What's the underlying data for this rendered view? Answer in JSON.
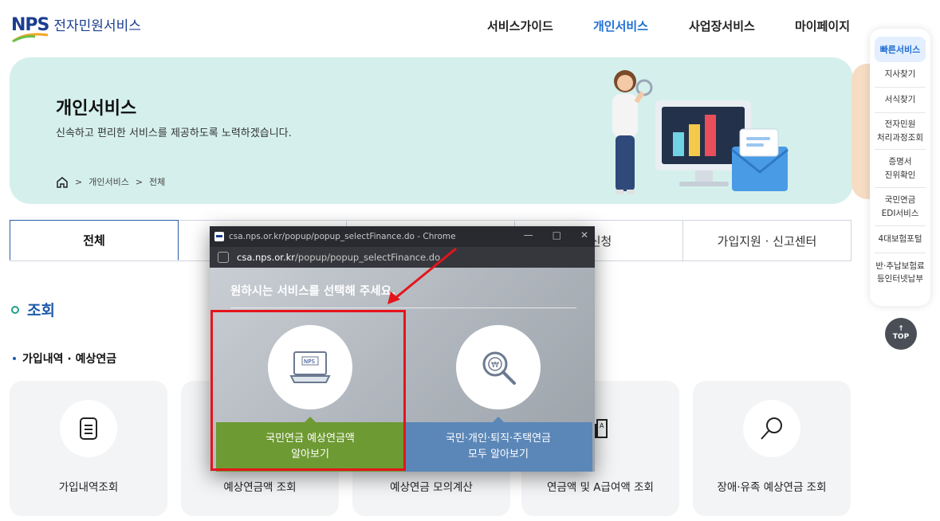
{
  "header": {
    "logo_mark": "NPS",
    "logo_text": "전자민원서비스",
    "nav": [
      {
        "label": "서비스가이드",
        "active": false
      },
      {
        "label": "개인서비스",
        "active": true
      },
      {
        "label": "사업장서비스",
        "active": false
      },
      {
        "label": "마이페이지",
        "active": false
      }
    ]
  },
  "hero": {
    "title": "개인서비스",
    "description": "신속하고 편리한 서비스를 제공하도록 노력하겠습니다.",
    "breadcrumb": [
      "개인서비스",
      "전체"
    ],
    "home_icon": "home-icon"
  },
  "tabs": [
    {
      "label": "전체",
      "active": true
    },
    {
      "label": "",
      "active": false
    },
    {
      "label": "",
      "active": false
    },
    {
      "label": "/신청",
      "active": false
    },
    {
      "label": "가입지원 · 신고센터",
      "active": false
    }
  ],
  "section": {
    "title": "조회",
    "subtitle": "가입내역 · 예상연금"
  },
  "cards": [
    {
      "label": "가입내역조회",
      "icon": "document-icon"
    },
    {
      "label": "예상연금액 조회",
      "icon": ""
    },
    {
      "label": "예상연금 모의계산",
      "icon": ""
    },
    {
      "label": "연금액 및 A급여액 조회",
      "icon": "calculator-icon"
    },
    {
      "label": "장애·유족 예상연금 조회",
      "icon": "search-icon"
    }
  ],
  "quick_menu": {
    "header": "빠른서비스",
    "items": [
      {
        "lines": [
          "지사찾기"
        ]
      },
      {
        "lines": [
          "서식찾기"
        ]
      },
      {
        "lines": [
          "전자민원",
          "처리과정조회"
        ]
      },
      {
        "lines": [
          "증명서",
          "진위확인"
        ]
      },
      {
        "lines": [
          "국민연금",
          "EDI서비스"
        ]
      },
      {
        "lines": [
          "4대보험포털"
        ]
      },
      {
        "lines": [
          "반·추납보험료",
          "등인터넷납부"
        ]
      }
    ],
    "top_label": "TOP"
  },
  "popup": {
    "window_title": "csa.nps.or.kr/popup/popup_selectFinance.do - Chrome",
    "url_host": "csa.nps.or.kr",
    "url_path": "/popup/popup_selectFinance.do",
    "heading": "원하시는 서비스를 선택해 주세요.",
    "choices": [
      {
        "lines": [
          "국민연금 예상연금액",
          "알아보기"
        ],
        "icon": "laptop-icon",
        "color": "#6e9a33"
      },
      {
        "lines": [
          "국민·개인·퇴직·주택연금",
          "모두 알아보기"
        ],
        "icon": "magnifier-won-icon",
        "color": "#5b87b8"
      }
    ],
    "laptop_label": "NPS"
  },
  "colors": {
    "brand": "#1a3d8f",
    "accent": "#1f6ed4",
    "hero_bg": "#d5f0ec",
    "highlight": "#e5141b"
  }
}
